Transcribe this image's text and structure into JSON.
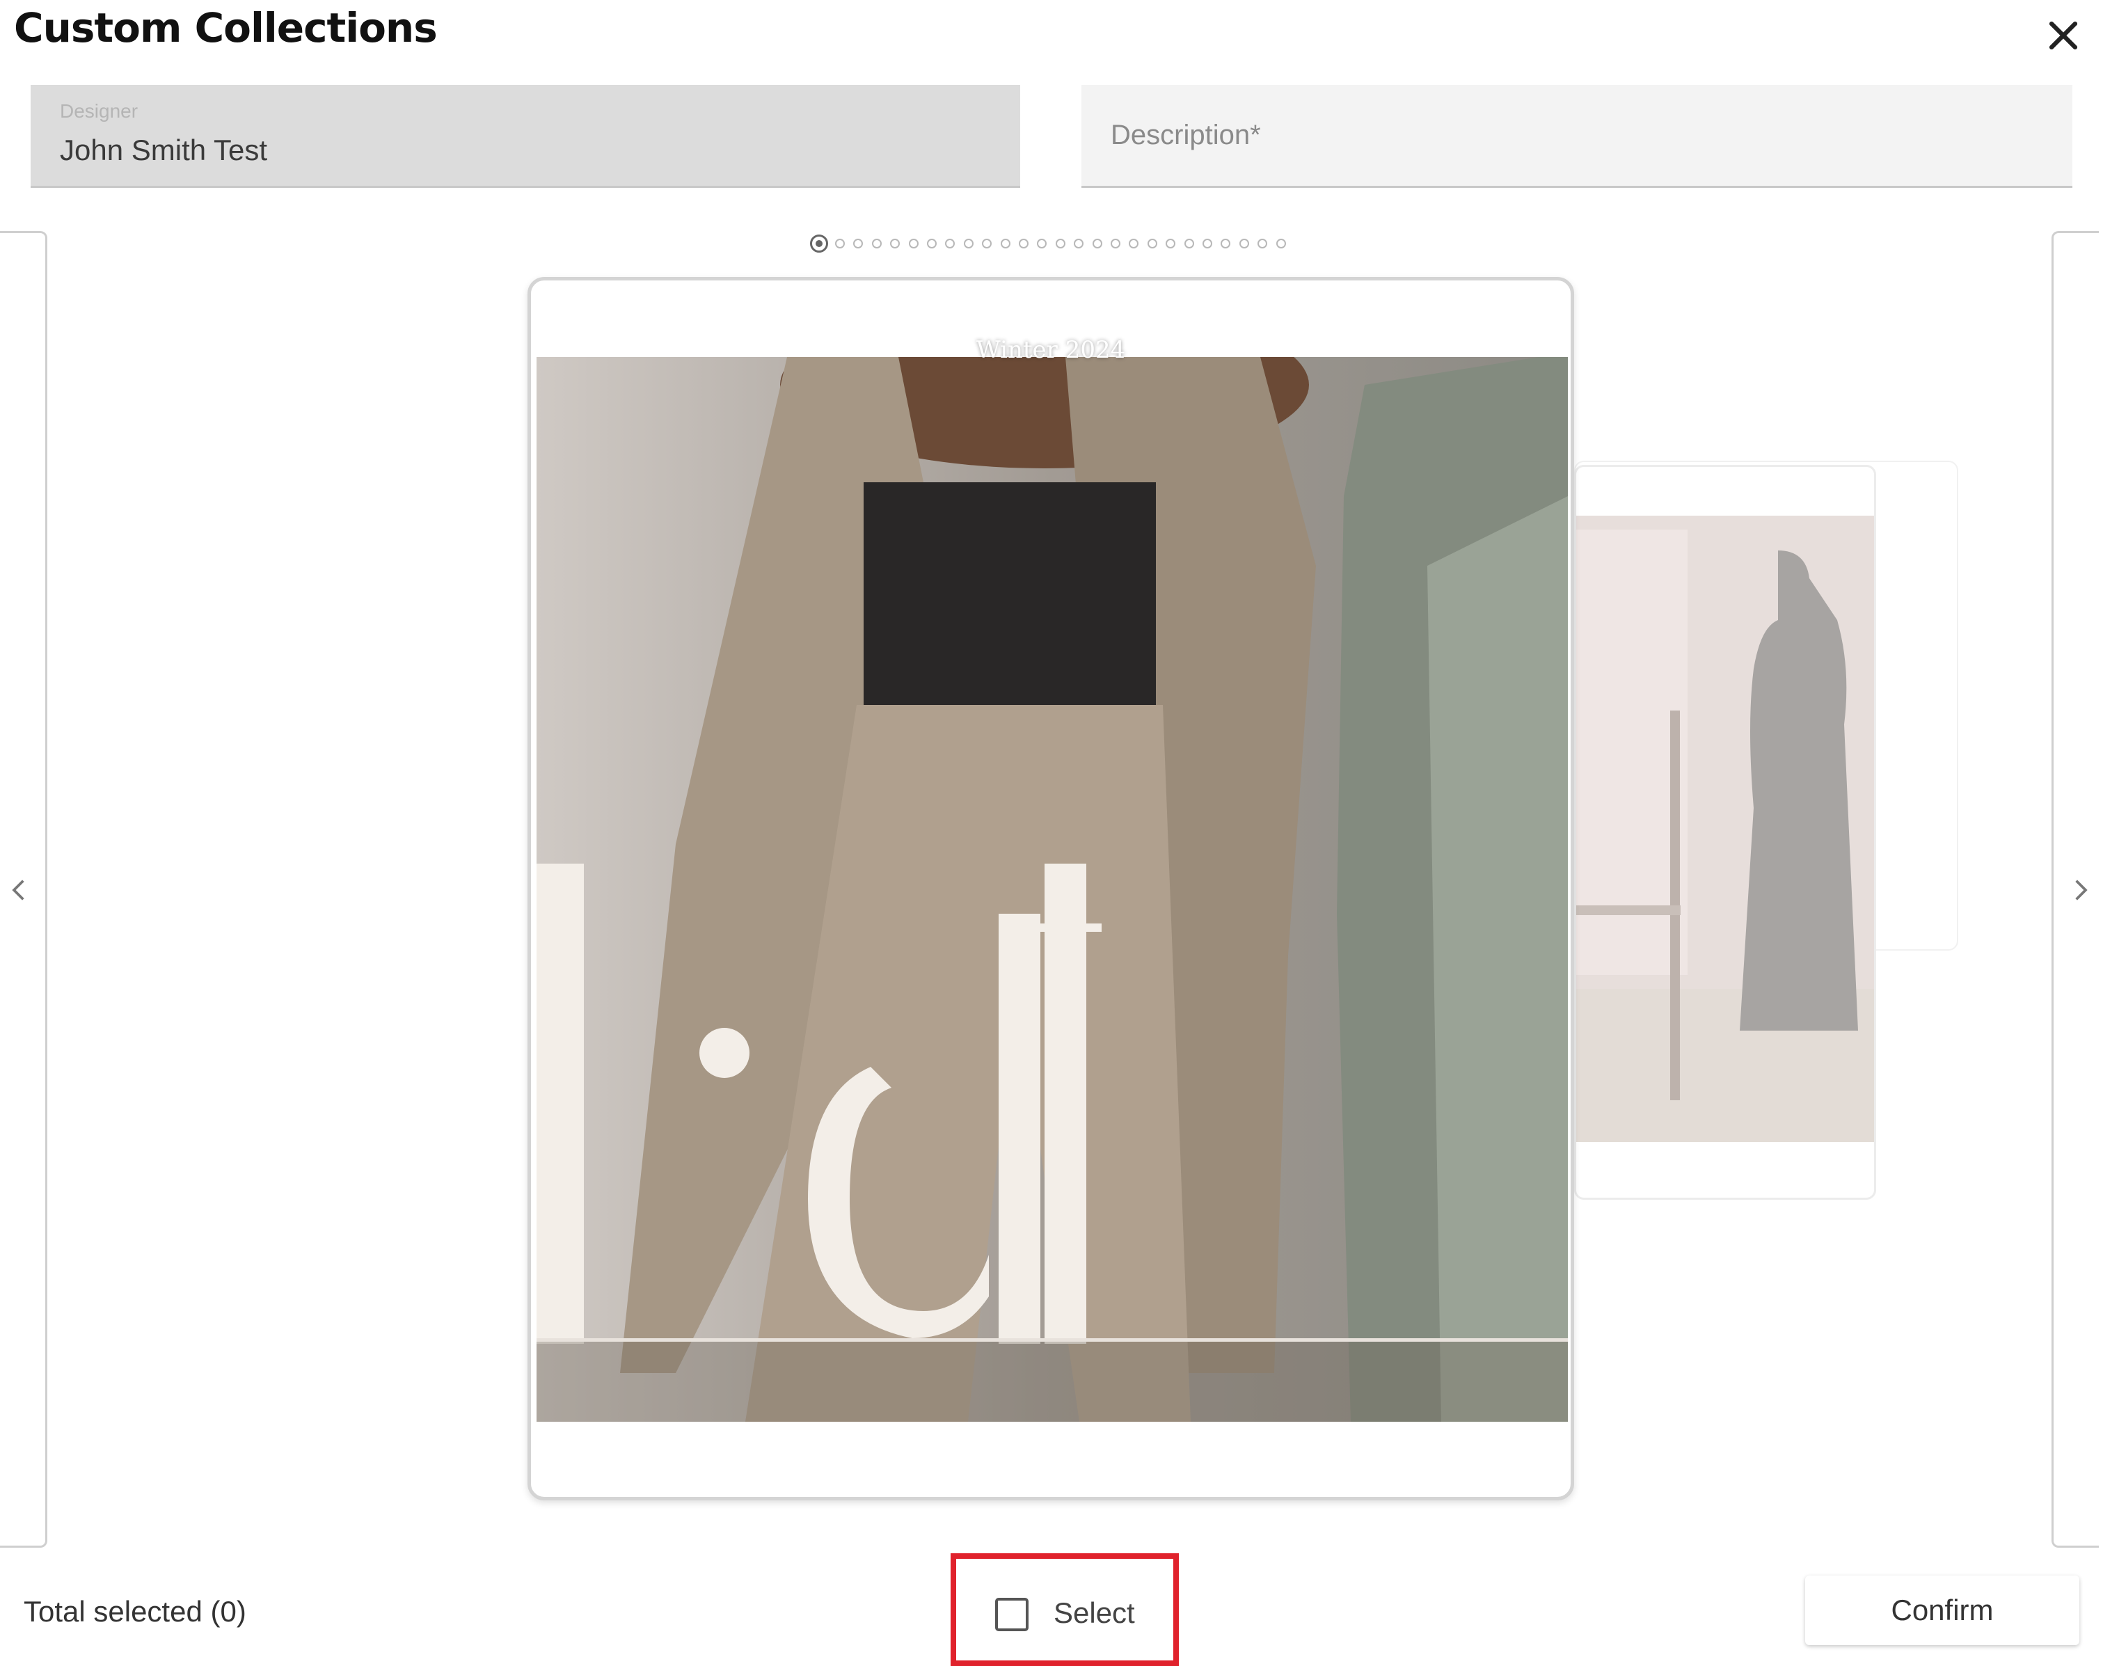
{
  "dialog": {
    "title": "Custom Collections",
    "close_icon": "close-icon"
  },
  "form": {
    "designer_label": "Designer",
    "designer_value": "John Smith Test",
    "description_placeholder": "Description*"
  },
  "carousel": {
    "page_count": 26,
    "active_page": 1,
    "current_card": {
      "label": "Winter 2024"
    },
    "prev_icon": "chevron-left-icon",
    "next_icon": "chevron-right-icon"
  },
  "footer": {
    "total_selected": "Total selected (0)",
    "select_label": "Select",
    "select_checked": false,
    "confirm_label": "Confirm"
  },
  "colors": {
    "highlight": "#e0222c",
    "field_disabled": "#dcdcdc",
    "field_empty": "#f3f3f3"
  }
}
